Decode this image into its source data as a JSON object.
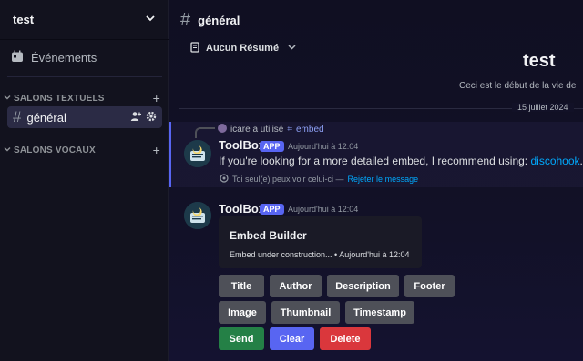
{
  "server": {
    "name": "test"
  },
  "sidebar": {
    "events_label": "Événements",
    "categories": [
      {
        "label": "SALONS TEXTUELS"
      },
      {
        "label": "SALONS VOCAUX"
      }
    ],
    "active_channel": "général"
  },
  "channel": {
    "title": "général",
    "summary_label": "Aucun Résumé",
    "welcome_title": "test",
    "welcome_sub": "Ceci est le début de la vie de",
    "date_divider": "15 juillet 2024"
  },
  "messages": [
    {
      "reply_user": "icare a utilisé",
      "reply_command": "embed",
      "username": "ToolBox",
      "badge": "APP",
      "time": "Aujourd'hui à 12:04",
      "text": "If you're looking for a more detailed embed, I recommend using:",
      "link": "discohook",
      "text_end": ".",
      "ephemeral_note": "Toi seul(e) peux voir celui-ci —",
      "dismiss_label": "Rejeter le message"
    },
    {
      "username": "ToolBox",
      "badge": "APP",
      "time": "Aujourd'hui à 12:04",
      "embed_title": "Embed Builder",
      "embed_footer": "Embed under construction... • Aujourd'hui à 12:04"
    }
  ],
  "buttons": {
    "title": "Title",
    "author": "Author",
    "description": "Description",
    "footer": "Footer",
    "image": "Image",
    "thumbnail": "Thumbnail",
    "timestamp": "Timestamp",
    "send": "Send",
    "clear": "Clear",
    "delete": "Delete"
  },
  "colors": {
    "accent": "#5865f2",
    "link": "#00a8fc",
    "send": "#248046",
    "delete": "#da373c",
    "grey_button": "#4e5058"
  }
}
